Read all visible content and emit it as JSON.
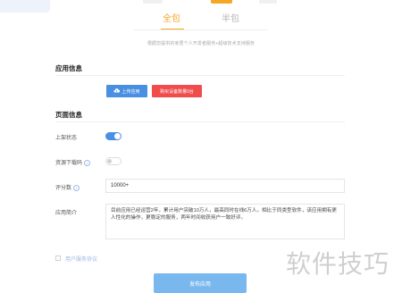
{
  "tabs": {
    "full": "全包",
    "half": "半包"
  },
  "note": "根据您提供的家居个人开发者服务+超级技术支持服务",
  "app_info": {
    "title": "应用信息",
    "upload_button": "上传应用",
    "device_button": "购买设备数量0台"
  },
  "page_info": {
    "title": "页面信息",
    "launch_status_label": "上架状态",
    "launch_status_on": true,
    "resource_download_label": "资源下载码",
    "resource_download_on": false,
    "rating_label": "评分数",
    "rating_value": "10000+",
    "intro_label": "应用简介",
    "intro_text": "目前应用已经运营2年，累计用户突破10万人，最高同时在线6万人。相比于同类型软件，该应用拥有更人性化的操作，更稳定的服务，两年时间收获用户一致好评。"
  },
  "agreement_text": "用户服务协议",
  "publish_button": "发布应用",
  "watermark_text": "软件技巧",
  "colors": {
    "accent_orange": "#f5a623",
    "primary_blue": "#4a90e2",
    "danger_red": "#f04c4c",
    "publish_blue": "#79b8ef"
  },
  "icons": {
    "upload": "cloud-upload-icon",
    "info": "info-circle-icon"
  }
}
